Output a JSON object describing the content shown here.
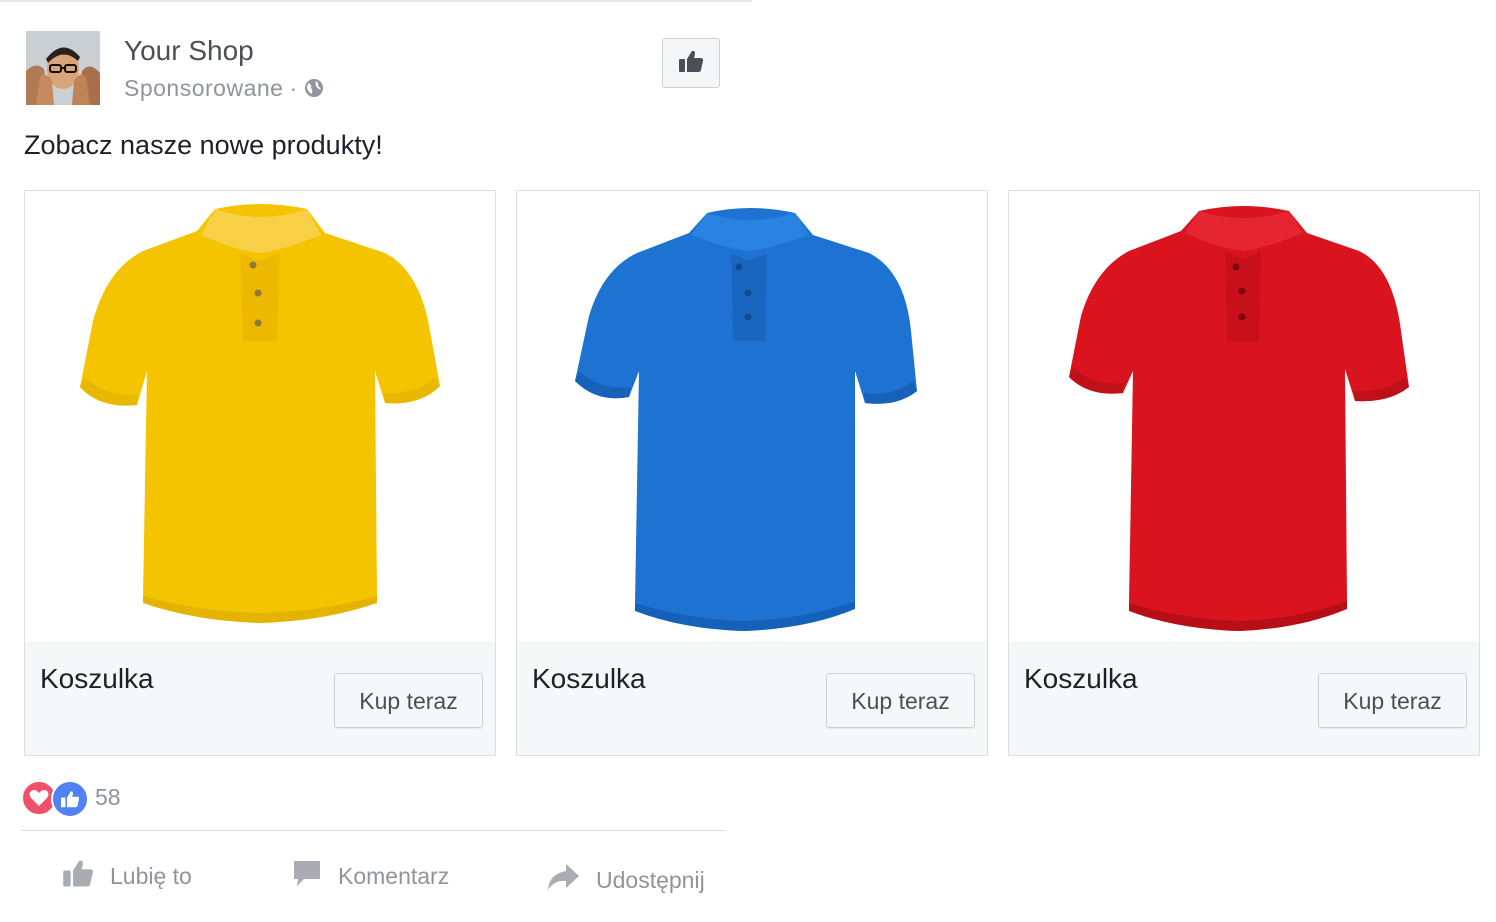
{
  "post": {
    "page_name": "Your Shop",
    "sponsored_label": "Sponsorowane",
    "separator": "·",
    "privacy_icon": "globe-icon",
    "like_page_icon": "thumbs-up-icon",
    "message": "Zobacz nasze nowe produkty!"
  },
  "carousel": {
    "cards": [
      {
        "title": "Koszulka",
        "button": "Kup teraz",
        "color": "#F5C400",
        "image": "yellow-polo-shirt"
      },
      {
        "title": "Koszulka",
        "button": "Kup teraz",
        "color": "#1E73D2",
        "image": "blue-polo-shirt"
      },
      {
        "title": "Koszulka",
        "button": "Kup teraz",
        "color": "#D9141E",
        "image": "red-polo-shirt"
      }
    ]
  },
  "reactions": {
    "types": [
      "love",
      "like"
    ],
    "count": "58"
  },
  "actions": {
    "like": "Lubię to",
    "comment": "Komentarz",
    "share": "Udostępnij"
  },
  "colors": {
    "love": "#F0506A",
    "like": "#4F82F2",
    "muted_text": "#90949C"
  }
}
